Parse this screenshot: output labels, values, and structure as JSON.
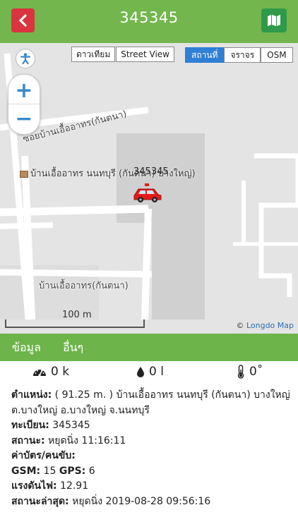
{
  "header": {
    "title": "345345",
    "back_icon": "chevron-left-icon",
    "map_icon": "map-icon"
  },
  "map": {
    "map_types": [
      "ดาวเทียม",
      "Street View"
    ],
    "overlays": [
      {
        "label": "สถานที่",
        "active": true
      },
      {
        "label": "จราจร",
        "active": false
      },
      {
        "label": "OSM",
        "active": false
      }
    ],
    "zoom_in": "+",
    "zoom_out": "−",
    "road_label_1": "ซอยบ้านเอื้ออาทร(กันตนา)",
    "road_label_2": "บ้านเอื้ออาทร(กันตนา)",
    "poi_label": "บ้านเอื้ออาทร นนทบุรี (กันตนา) บางใหญ่)",
    "vehicle_label": "345345",
    "scale": "100 m",
    "attribution_symbol": "©",
    "attribution": "Longdo Map"
  },
  "tabs": [
    "ข้อมูล",
    "อื่นๆ"
  ],
  "stats": {
    "speed": "0 k",
    "fuel": "0 l",
    "temp": "0˚"
  },
  "info": {
    "location_label": "ตำแหน่ง:",
    "location_value": "( 91.25 m. ) บ้านเอื้ออาทร นนทบุรี (กันตนา) บางใหญ่ ต.บางใหญ่ อ.บางใหญ่ จ.นนทบุรี",
    "plate_label": "ทะเบียน:",
    "plate_value": "345345",
    "status_label": "สถานะ:",
    "status_value": "หยุดนิ่ง 11:16:11",
    "card_label": "ค่าบัตร/คนขับ:",
    "gsm_label": "GSM:",
    "gsm_value": "15",
    "gps_label": "GPS:",
    "gps_value": "6",
    "voltage_label": "แรงดันไฟ:",
    "voltage_value": "12.91",
    "latest_label": "สถานะล่าสุด:",
    "latest_value": "หยุดนิ่ง 2019-08-28 09:56:16"
  },
  "colors": {
    "header": "#73b64e",
    "back": "#d9343f",
    "map_btn": "#2f9a4a",
    "tabs": "#6db44a",
    "active_overlay": "#2f7fd6"
  }
}
